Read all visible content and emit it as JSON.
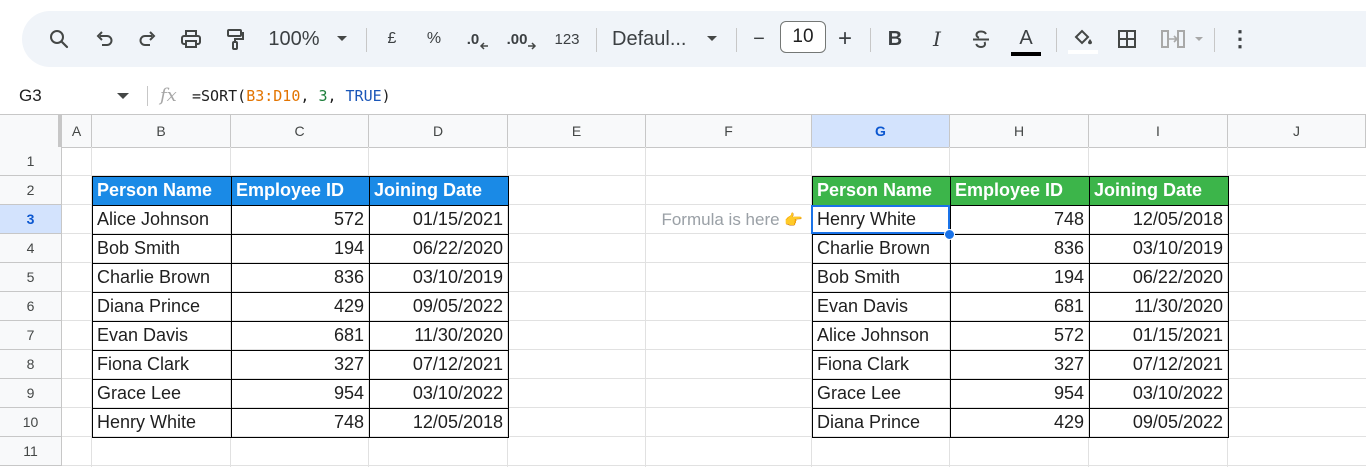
{
  "toolbar": {
    "zoom": "100%",
    "currency": "£",
    "percent": "%",
    "decrease_decimal": ".0",
    "increase_decimal": ".00",
    "number_format": "123",
    "font": "Defaul...",
    "font_size": "10",
    "minus": "−",
    "plus": "+",
    "bold": "B",
    "italic": "I",
    "text_color_letter": "A",
    "more": "⋮",
    "icons": [
      "search-icon",
      "undo-icon",
      "redo-icon",
      "print-icon",
      "paint-format-icon",
      "zoom-dropdown-icon",
      "font-dropdown-icon",
      "strikethrough-icon",
      "text-color-icon",
      "fill-color-icon",
      "borders-icon",
      "merge-cells-icon",
      "more-vert-icon"
    ]
  },
  "formula_bar": {
    "cell_ref": "G3",
    "fx": "fx",
    "formula_prefix": "=SORT(",
    "formula_range": "B3:D10",
    "formula_sep1": ", ",
    "formula_col": "3",
    "formula_sep2": ", ",
    "formula_bool": "TRUE",
    "formula_suffix": ")"
  },
  "columns": [
    "A",
    "B",
    "C",
    "D",
    "E",
    "F",
    "G",
    "H",
    "I",
    "J"
  ],
  "rows": [
    "1",
    "2",
    "3",
    "4",
    "5",
    "6",
    "7",
    "8",
    "9",
    "10",
    "11"
  ],
  "active": {
    "column": "G",
    "row": "3"
  },
  "colors": {
    "left_header": "#1a8ae6",
    "right_header": "#3cb54a",
    "selection": "#1a73e8"
  },
  "left_table": {
    "headers": [
      "Person Name",
      "Employee ID",
      "Joining Date"
    ],
    "rows": [
      [
        "Alice Johnson",
        "572",
        "01/15/2021"
      ],
      [
        "Bob Smith",
        "194",
        "06/22/2020"
      ],
      [
        "Charlie Brown",
        "836",
        "03/10/2019"
      ],
      [
        "Diana Prince",
        "429",
        "09/05/2022"
      ],
      [
        "Evan Davis",
        "681",
        "11/30/2020"
      ],
      [
        "Fiona Clark",
        "327",
        "07/12/2021"
      ],
      [
        "Grace Lee",
        "954",
        "03/10/2022"
      ],
      [
        "Henry White",
        "748",
        "12/05/2018"
      ]
    ]
  },
  "note": {
    "text": "Formula is here",
    "hand": "👉"
  },
  "right_table": {
    "headers": [
      "Person Name",
      "Employee ID",
      "Joining Date"
    ],
    "rows": [
      [
        "Henry White",
        "748",
        "12/05/2018"
      ],
      [
        "Charlie Brown",
        "836",
        "03/10/2019"
      ],
      [
        "Bob Smith",
        "194",
        "06/22/2020"
      ],
      [
        "Evan Davis",
        "681",
        "11/30/2020"
      ],
      [
        "Alice Johnson",
        "572",
        "01/15/2021"
      ],
      [
        "Fiona Clark",
        "327",
        "07/12/2021"
      ],
      [
        "Grace Lee",
        "954",
        "03/10/2022"
      ],
      [
        "Diana Prince",
        "429",
        "09/05/2022"
      ]
    ]
  }
}
